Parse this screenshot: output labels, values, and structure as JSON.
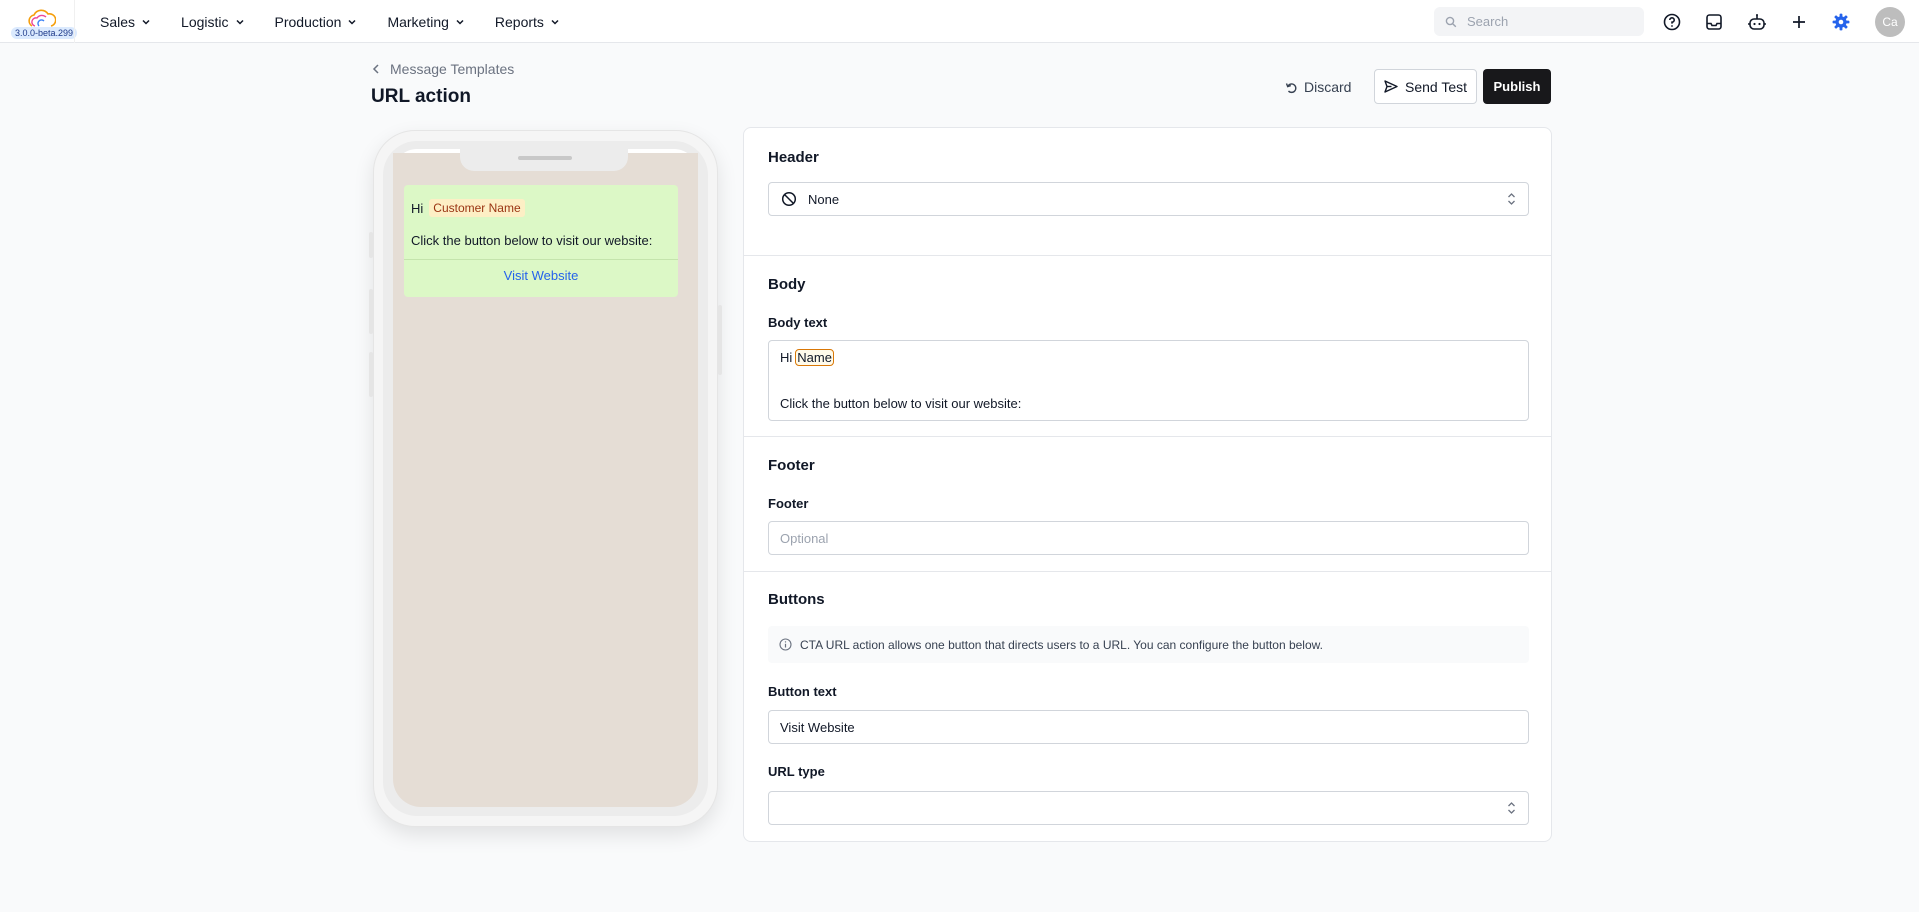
{
  "app": {
    "version": "3.0.0-beta.299"
  },
  "nav": {
    "items": [
      {
        "label": "Sales"
      },
      {
        "label": "Logistic"
      },
      {
        "label": "Production"
      },
      {
        "label": "Marketing"
      },
      {
        "label": "Reports"
      }
    ],
    "search_placeholder": "Search",
    "avatar_initials": "Ca"
  },
  "page": {
    "breadcrumb": "Message Templates",
    "title": "URL action",
    "discard_label": "Discard",
    "send_test_label": "Send Test",
    "publish_label": "Publish"
  },
  "preview": {
    "greeting": "Hi",
    "variable_chip": "Customer Name",
    "body_line": "Click the button below to visit our website:",
    "button_label": "Visit Website"
  },
  "form": {
    "header": {
      "title": "Header",
      "select_value": "None"
    },
    "body": {
      "title": "Body",
      "field_label": "Body text",
      "greeting": "Hi",
      "variable": "Name",
      "line2": "Click the button below to visit our website:"
    },
    "footer": {
      "title": "Footer",
      "field_label": "Footer",
      "placeholder": "Optional",
      "value": ""
    },
    "buttons": {
      "title": "Buttons",
      "info": "CTA URL action allows one button that directs users to a URL. You can configure the button below.",
      "button_text_label": "Button text",
      "button_text_value": "Visit Website",
      "url_type_label": "URL type",
      "url_type_value": ""
    }
  },
  "colors": {
    "accent": "#2563eb",
    "publish_bg": "#18181b",
    "bubble_bg": "#dcf8c6",
    "chat_bg": "#e5ddd5"
  }
}
